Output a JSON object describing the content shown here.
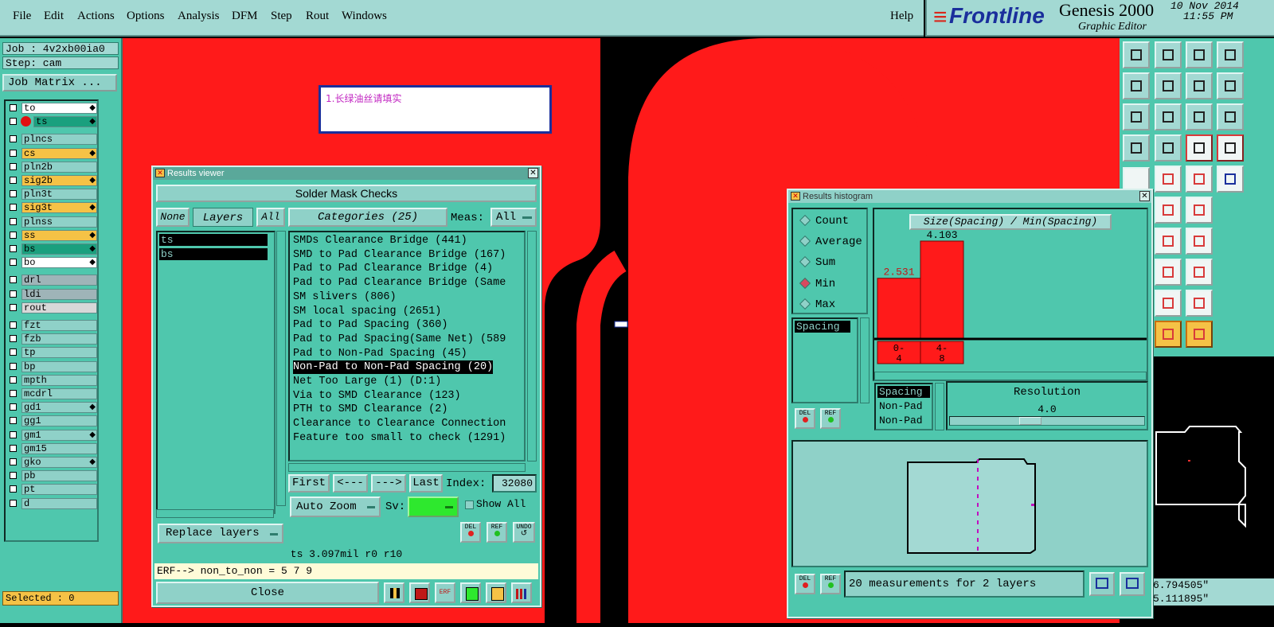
{
  "menubar": {
    "items": [
      "File",
      "Edit",
      "Actions",
      "Options",
      "Analysis",
      "DFM",
      "Step",
      "Rout",
      "Windows"
    ],
    "help": "Help"
  },
  "brand": {
    "logo": "Frontline",
    "product": "Genesis 2000",
    "subtitle": "Graphic Editor",
    "date": "10 Nov 2014",
    "time": "11:55 PM"
  },
  "left": {
    "job": "Job : 4v2xb00ia0",
    "step": "Step: cam",
    "job_matrix": "Job Matrix ...",
    "selected": "Selected : 0",
    "layers": [
      {
        "name": "to",
        "color": "#ffffff",
        "mark": "◆"
      },
      {
        "name": "ts",
        "color": "#1aa07e",
        "mark": "◆"
      },
      {
        "name": "plncs",
        "color": "#8fd1c8",
        "mark": ""
      },
      {
        "name": "cs",
        "color": "#f5c246",
        "mark": "◆"
      },
      {
        "name": "pln2b",
        "color": "#8fd1c8",
        "mark": ""
      },
      {
        "name": "sig2b",
        "color": "#f5c246",
        "mark": "◆"
      },
      {
        "name": "pln3t",
        "color": "#8fd1c8",
        "mark": ""
      },
      {
        "name": "sig3t",
        "color": "#f5c246",
        "mark": "◆"
      },
      {
        "name": "plnss",
        "color": "#8fd1c8",
        "mark": ""
      },
      {
        "name": "ss",
        "color": "#f5c246",
        "mark": "◆"
      },
      {
        "name": "bs",
        "color": "#1aa07e",
        "mark": "◆"
      },
      {
        "name": "bo",
        "color": "#ffffff",
        "mark": "◆"
      },
      {
        "name": "drl",
        "color": "#9fb4b8",
        "mark": ""
      },
      {
        "name": "ldi",
        "color": "#9fb4b8",
        "mark": ""
      },
      {
        "name": "rout",
        "color": "#d8d8d8",
        "mark": ""
      },
      {
        "name": "fzt",
        "color": "#8fd1c8",
        "mark": ""
      },
      {
        "name": "fzb",
        "color": "#8fd1c8",
        "mark": ""
      },
      {
        "name": "tp",
        "color": "#8fd1c8",
        "mark": ""
      },
      {
        "name": "bp",
        "color": "#8fd1c8",
        "mark": ""
      },
      {
        "name": "mpth",
        "color": "#8fd1c8",
        "mark": ""
      },
      {
        "name": "mcdrl",
        "color": "#8fd1c8",
        "mark": ""
      },
      {
        "name": "gd1",
        "color": "#8fd1c8",
        "mark": "◆"
      },
      {
        "name": "gg1",
        "color": "#8fd1c8",
        "mark": ""
      },
      {
        "name": "gm1",
        "color": "#8fd1c8",
        "mark": "◆"
      },
      {
        "name": "gm15",
        "color": "#8fd1c8",
        "mark": ""
      },
      {
        "name": "gko",
        "color": "#8fd1c8",
        "mark": "◆"
      },
      {
        "name": "pb",
        "color": "#8fd1c8",
        "mark": ""
      },
      {
        "name": "pt",
        "color": "#8fd1c8",
        "mark": ""
      },
      {
        "name": "d",
        "color": "#8fd1c8",
        "mark": ""
      }
    ]
  },
  "canvas": {
    "note": "1.长绿油丝请填实"
  },
  "results_viewer": {
    "title": "Results viewer",
    "header": "Solder Mask Checks",
    "none_btn": "None",
    "layers_label": "Layers",
    "all_btn": "All",
    "layers": [
      "ts",
      "bs"
    ],
    "categories_label": "Categories (25)",
    "meas_label": "Meas:",
    "meas_value": "All",
    "categories": [
      "SMDs Clearance Bridge (441)",
      "SMD to Pad Clearance Bridge (167)",
      "Pad to Pad Clearance Bridge (4)",
      "Pad to Pad Clearance Bridge (Same",
      "SM slivers (806)",
      "SM local spacing (2651)",
      "Pad to Pad Spacing (360)",
      "Pad to Pad Spacing(Same Net) (589",
      "Pad to Non-Pad Spacing (45)",
      "Non-Pad to Non-Pad Spacing (20)",
      "Net Too Large (1)        (D:1)",
      "Via to SMD Clearance (123)",
      "PTH to SMD Clearance (2)",
      "Clearance to Clearance Connection",
      "Feature too small to check (1291)"
    ],
    "selected_category_index": 9,
    "first": "First",
    "prev": "<---",
    "next": "--->",
    "last": "Last",
    "index_label": "Index:",
    "index_value": "32080",
    "auto_zoom": "Auto Zoom",
    "sv_label": "Sv:",
    "show_all": "Show All",
    "replace_layers": "Replace layers",
    "del": "DEL",
    "ref": "REF",
    "undo": "UNDO",
    "status": "ts 3.097mil  r0  r10",
    "erf": "ERF--> non_to_non = 5 7 9",
    "close": "Close"
  },
  "histogram": {
    "title": "Results histogram",
    "options": [
      "Count",
      "Average",
      "Sum",
      "Min",
      "Max"
    ],
    "selected_option": "Min",
    "list_item": "Spacing",
    "chart_title": "Size(Spacing) / Min(Spacing)",
    "del": "DEL",
    "ref": "REF",
    "measure_list": [
      "Spacing",
      "Non-Pad",
      "Non-Pad"
    ],
    "resolution_label": "Resolution",
    "resolution_value": "4.0",
    "resolution_fraction": 0.4,
    "summary": "20 measurements for 2 layers",
    "chart_data": {
      "type": "bar",
      "title": "Size(Spacing) / Min(Spacing)",
      "categories": [
        "0-4",
        "4-8"
      ],
      "values": [
        2.531,
        4.103
      ],
      "value_labels": [
        "2.531",
        "4.103"
      ],
      "bar_color": "#ff1a1a",
      "ylim": [
        0,
        4.103
      ]
    }
  },
  "coords": {
    "x": "6.794505\"",
    "y": "5.111895\""
  }
}
